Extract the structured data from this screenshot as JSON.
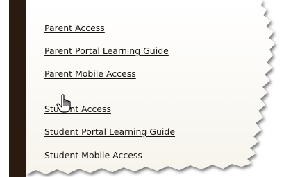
{
  "links": [
    {
      "label": "Parent Access"
    },
    {
      "label": "Parent Portal Learning Guide"
    },
    {
      "label": "Parent Mobile Access"
    },
    {
      "label": "Student Access"
    },
    {
      "label": "Student Portal Learning Guide"
    },
    {
      "label": "Student Mobile Access"
    }
  ],
  "cursor": {
    "icon": "hand-pointer-icon"
  },
  "colors": {
    "sidebar": "#2a1a10",
    "link_text": "#1a1510",
    "panel_background": "#fdfcf9"
  }
}
